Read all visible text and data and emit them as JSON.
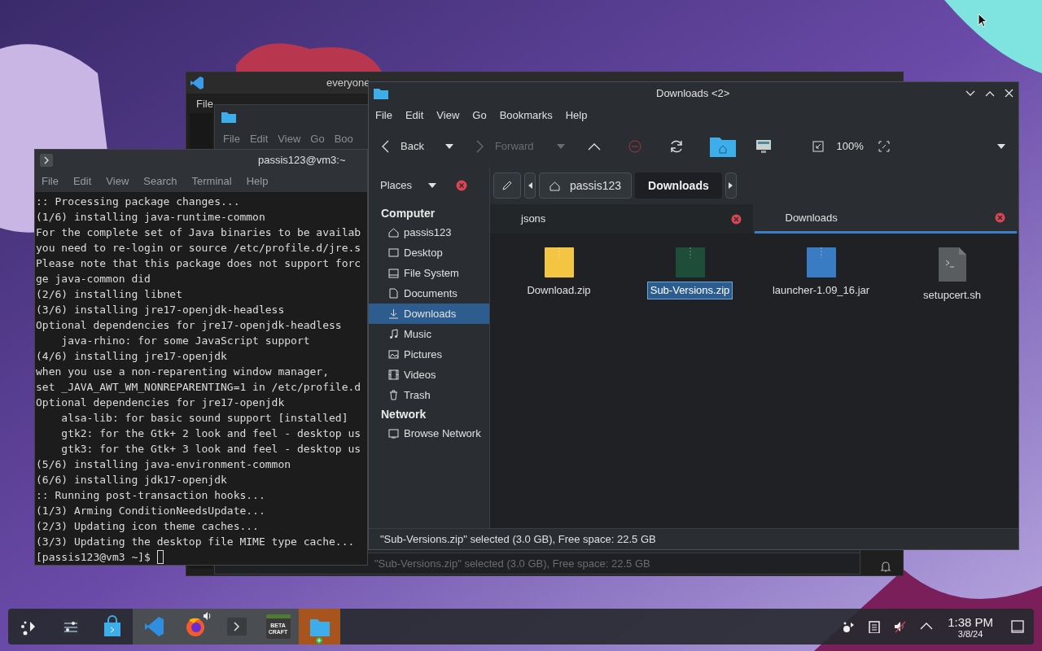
{
  "background_windows": {
    "code_editor": {
      "title": "everyone",
      "menu": [
        "File"
      ]
    },
    "file_manager": {
      "menu": [
        "File",
        "Edit",
        "View",
        "Go",
        "Boo"
      ],
      "status": "\"Sub-Versions.zip\" selected (3.0 GB), Free space: 22.5 GB"
    }
  },
  "terminal": {
    "title": "passis123@vm3:~",
    "menu": [
      "File",
      "Edit",
      "View",
      "Search",
      "Terminal",
      "Help"
    ],
    "lines": [
      ":: Processing package changes...",
      "(1/6) installing java-runtime-common",
      "For the complete set of Java binaries to be availab",
      "you need to re-login or source /etc/profile.d/jre.s",
      "Please note that this package does not support forc",
      "ge java-common did",
      "(2/6) installing libnet",
      "(3/6) installing jre17-openjdk-headless",
      "Optional dependencies for jre17-openjdk-headless",
      "    java-rhino: for some JavaScript support",
      "(4/6) installing jre17-openjdk",
      "when you use a non-reparenting window manager,",
      "set _JAVA_AWT_WM_NONREPARENTING=1 in /etc/profile.d",
      "Optional dependencies for jre17-openjdk",
      "    alsa-lib: for basic sound support [installed]",
      "    gtk2: for the Gtk+ 2 look and feel - desktop us",
      "    gtk3: for the Gtk+ 3 look and feel - desktop us",
      "(5/6) installing java-environment-common",
      "(6/6) installing jdk17-openjdk",
      ":: Running post-transaction hooks...",
      "(1/3) Arming ConditionNeedsUpdate...",
      "(2/3) Updating icon theme caches...",
      "(3/3) Updating the desktop file MIME type cache..."
    ],
    "prompt": "[passis123@vm3 ~]$ "
  },
  "file_manager": {
    "title": "Downloads <2>",
    "menu": [
      "File",
      "Edit",
      "View",
      "Go",
      "Bookmarks",
      "Help"
    ],
    "back": {
      "label": "Back",
      "disabled": false
    },
    "forward": {
      "label": "Forward",
      "disabled": true
    },
    "zoom": "100%",
    "places_label": "Places",
    "breadcrumb": [
      {
        "label": "passis123",
        "selected": false
      },
      {
        "label": "Downloads",
        "selected": true
      }
    ],
    "tabs": [
      {
        "label": "jsons",
        "selected": false
      },
      {
        "label": "Downloads",
        "selected": true
      }
    ],
    "sidebar": [
      {
        "heading": "Computer",
        "items": [
          {
            "label": "passis123",
            "kind": "home",
            "selected": false
          },
          {
            "label": "Desktop",
            "kind": "desktop",
            "selected": false
          },
          {
            "label": "File System",
            "kind": "drive",
            "selected": false
          },
          {
            "label": "Documents",
            "kind": "document",
            "selected": false
          },
          {
            "label": "Downloads",
            "kind": "download",
            "selected": true
          },
          {
            "label": "Music",
            "kind": "music",
            "selected": false
          },
          {
            "label": "Pictures",
            "kind": "picture",
            "selected": false
          },
          {
            "label": "Videos",
            "kind": "video",
            "selected": false
          },
          {
            "label": "Trash",
            "kind": "trash",
            "selected": false
          }
        ]
      },
      {
        "heading": "Network",
        "items": [
          {
            "label": "Browse Network",
            "kind": "network",
            "selected": false
          }
        ]
      }
    ],
    "files": [
      {
        "name": "Download.zip",
        "kind": "archive",
        "color": "#f4c542",
        "selected": false
      },
      {
        "name": "Sub-Versions.zip",
        "kind": "archive",
        "color": "#1e4d3a",
        "selected": true
      },
      {
        "name": "launcher-1.09_16.jar",
        "kind": "archive",
        "color": "#3a7cc4",
        "selected": false
      },
      {
        "name": "setupcert.sh",
        "kind": "script",
        "color": "#5a5d60",
        "selected": false
      }
    ],
    "status": "\"Sub-Versions.zip\" selected (3.0 GB), Free space: 22.5 GB"
  },
  "taskbar": {
    "apps": [
      {
        "kind": "launcher",
        "open": false,
        "selected": false
      },
      {
        "kind": "settings",
        "open": false,
        "selected": false
      },
      {
        "kind": "store",
        "open": false,
        "selected": false
      },
      {
        "kind": "code",
        "open": true,
        "selected": false
      },
      {
        "kind": "browser",
        "open": true,
        "selected": false,
        "playing_audio": true
      },
      {
        "kind": "terminal",
        "open": true,
        "selected": false
      },
      {
        "kind": "game",
        "open": true,
        "selected": false,
        "logo_lines": [
          "BETA",
          "CRAFT"
        ]
      },
      {
        "kind": "files",
        "open": true,
        "selected": true
      }
    ],
    "tray": [
      {
        "kind": "connect"
      },
      {
        "kind": "clipboard"
      },
      {
        "kind": "volume-muted"
      },
      {
        "kind": "expand"
      }
    ],
    "time": "1:38 PM",
    "date": "3/8/24"
  }
}
